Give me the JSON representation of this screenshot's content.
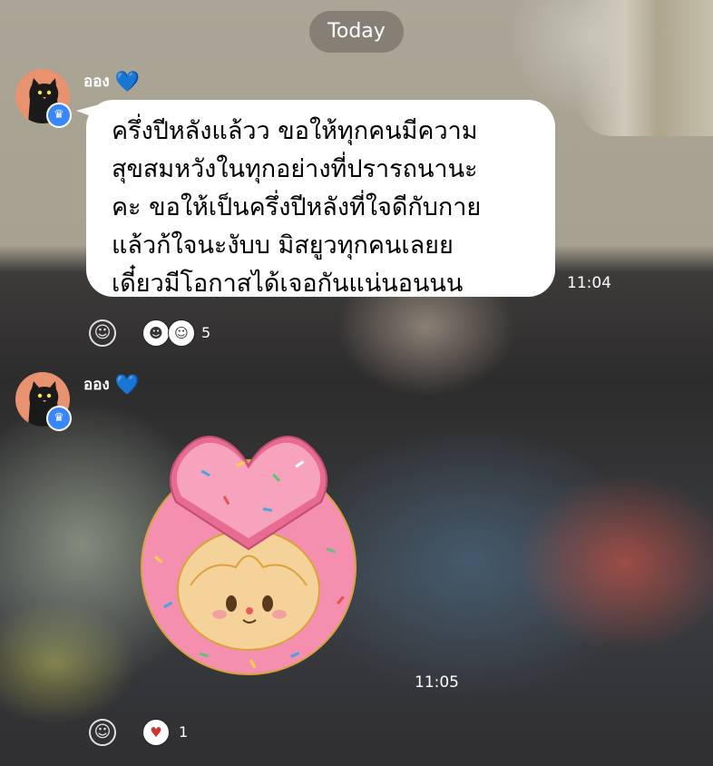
{
  "date_divider": "Today",
  "messages": [
    {
      "sender": "ออง",
      "sender_heart": "💙",
      "avatar_icon": "black-cat-avatar-icon",
      "badge_icon": "crown-icon",
      "lines": [
        "ครึ่งปีหลังแล้วว ขอให้ทุกคนมีความ",
        "สุขสมหวังในทุกอย่างที่ปรารถนานะ",
        "คะ ขอให้เป็นครึ่งปีหลังที่ใจดีกับกาย",
        "แล้วก้ใจนะงับบ มิสยูวทุกคนเลยย",
        "เดี๋ยวมีโอกาสได้เจอกันแน่นอนนน"
      ],
      "time": "11:04",
      "reactions": {
        "add_icon": "smiley-add-reaction-icon",
        "icons": [
          "sticker-face-1",
          "sticker-face-2"
        ],
        "count": "5"
      }
    },
    {
      "sender": "ออง",
      "sender_heart": "💙",
      "avatar_icon": "black-cat-avatar-icon",
      "badge_icon": "crown-icon",
      "sticker": "pink-donut-heart-sticker",
      "time": "11:05",
      "reactions": {
        "add_icon": "smiley-add-reaction-icon",
        "icons": [
          "heart-eyes-face"
        ],
        "count": "1"
      }
    }
  ],
  "colors": {
    "bubble": "#ffffff",
    "badge": "#3a86ff",
    "avatar_bg": "#e9926f",
    "donut": "#f48fb0"
  }
}
